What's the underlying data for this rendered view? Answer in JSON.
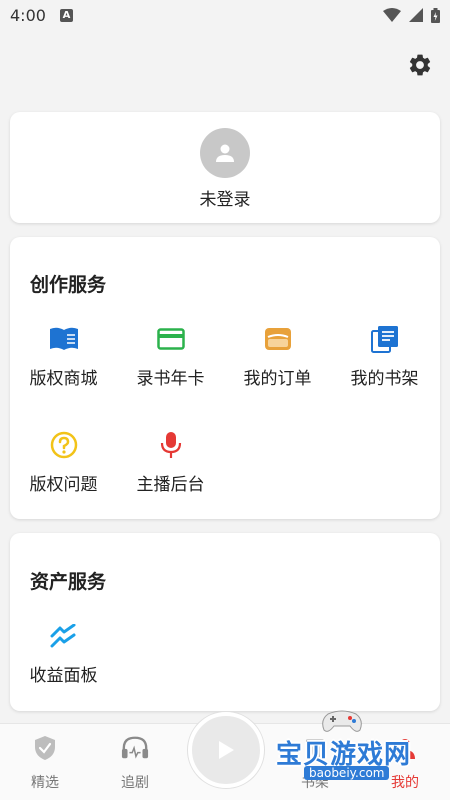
{
  "status_bar": {
    "time": "4:00",
    "indicator": "A"
  },
  "header": {
    "settings_icon": "gear-icon"
  },
  "user_card": {
    "avatar_icon": "person-icon",
    "login_label": "未登录"
  },
  "create_service": {
    "title": "创作服务",
    "items": [
      {
        "label": "版权商城",
        "icon": "book-open-icon",
        "color": "#1e73d2"
      },
      {
        "label": "录书年卡",
        "icon": "card-icon",
        "color": "#2bb24c"
      },
      {
        "label": "我的订单",
        "icon": "wallet-icon",
        "color": "#e8a13a"
      },
      {
        "label": "我的书架",
        "icon": "bookshelf-icon",
        "color": "#1e73d2"
      },
      {
        "label": "版权问题",
        "icon": "help-circle-icon",
        "color": "#f2c318"
      },
      {
        "label": "主播后台",
        "icon": "microphone-icon",
        "color": "#e53935"
      }
    ]
  },
  "asset_service": {
    "title": "资产服务",
    "items": [
      {
        "label": "收益面板",
        "icon": "trend-icon",
        "color": "#1aa0e8"
      }
    ]
  },
  "tab_bar": {
    "tabs": [
      {
        "label": "精选",
        "icon": "shield-check-icon"
      },
      {
        "label": "追剧",
        "icon": "headphones-icon"
      },
      {
        "label": "书架",
        "icon": "bookshelf-icon"
      },
      {
        "label": "我的",
        "icon": "user-icon",
        "active": true
      }
    ],
    "play_icon": "play-icon",
    "active_color": "#e53935"
  },
  "watermark": {
    "name": "宝贝游戏网",
    "url": "baobeiy.com"
  }
}
